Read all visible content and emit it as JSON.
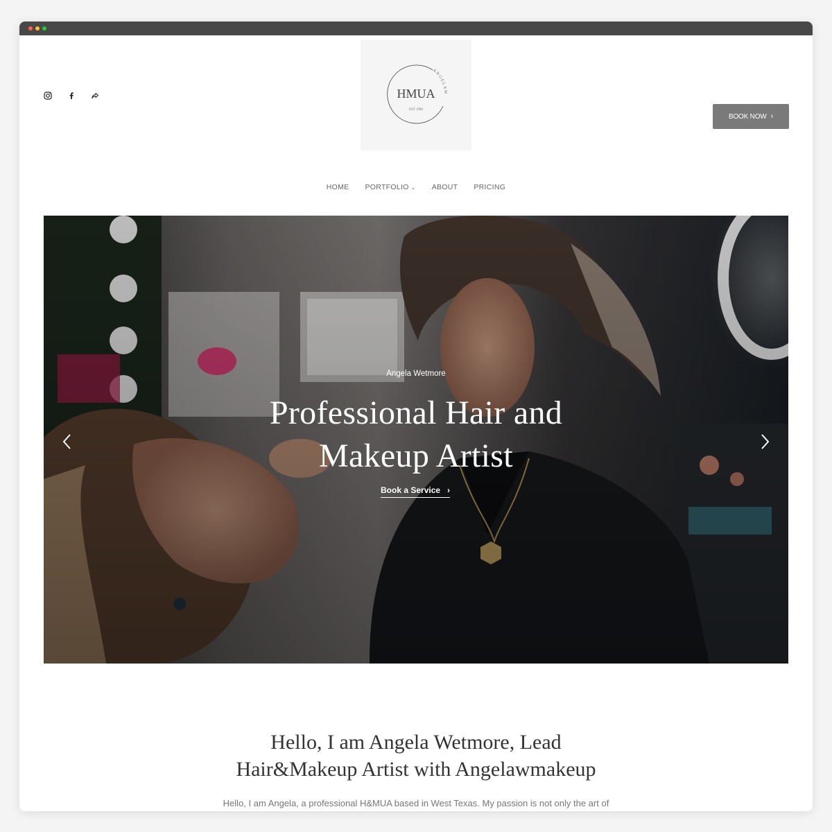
{
  "header": {
    "logo": {
      "main": "HMUA",
      "arc": "ANGELAW",
      "est": "EST 1980"
    },
    "book_now": "BOOK NOW",
    "social": [
      "instagram-icon",
      "facebook-icon",
      "share-icon"
    ]
  },
  "nav": {
    "items": [
      {
        "label": "HOME"
      },
      {
        "label": "PORTFOLIO",
        "has_caret": true
      },
      {
        "label": "ABOUT"
      },
      {
        "label": "PRICING"
      }
    ]
  },
  "hero": {
    "kicker": "Angela Wetmore",
    "title_line1": "Professional Hair and",
    "title_line2": "Makeup Artist",
    "cta": "Book a Service"
  },
  "intro": {
    "heading_line1": "Hello, I am Angela Wetmore, Lead",
    "heading_line2": "Hair&Makeup Artist with Angelawmakeup",
    "body": "Hello, I am Angela, a professional H&MUA based in West Texas. My passion is not only the art of"
  },
  "colors": {
    "button_bg": "#7a7a7a",
    "frame_bar": "#484848",
    "heading_text": "#333333",
    "body_text": "#777777"
  }
}
